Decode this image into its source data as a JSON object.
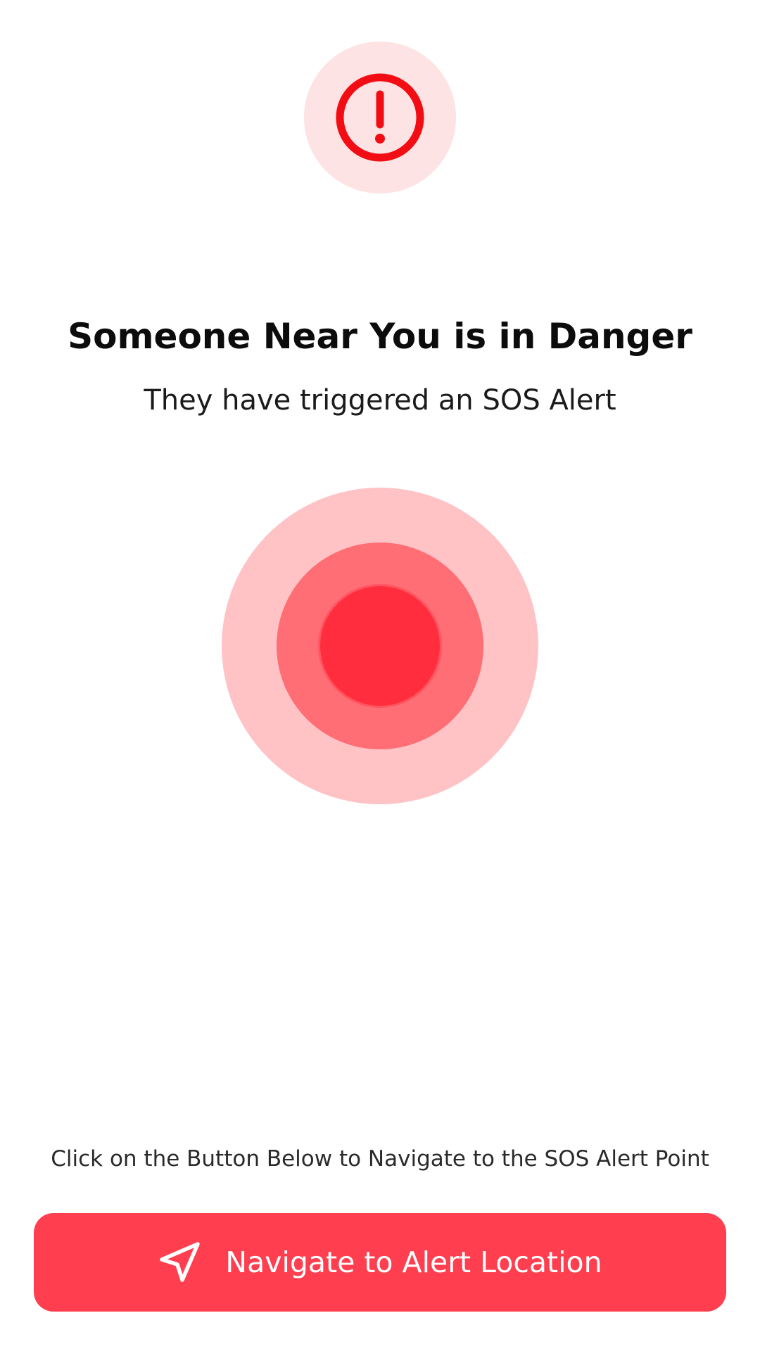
{
  "header": {
    "icon": "alert-circle-icon",
    "icon_color": "#f20d14",
    "badge_color": "#fde3e3"
  },
  "alert": {
    "title": "Someone Near You is in Danger",
    "subtitle": "They have triggered an SOS Alert"
  },
  "pulse": {
    "icon": "sos-pulse-indicator",
    "colors": {
      "outer": "#ffc3c6",
      "middle": "#ff6d75",
      "core": "#ff2d3d"
    }
  },
  "footer": {
    "hint": "Click on the Button Below to Navigate to the SOS Alert Point",
    "button_label": "Navigate to Alert Location",
    "button_icon": "navigation-arrow-icon",
    "button_color": "#ff3f4f"
  }
}
